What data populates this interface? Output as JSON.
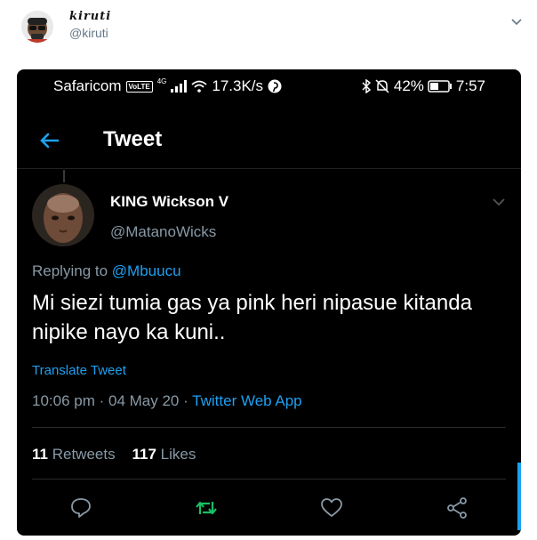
{
  "outer": {
    "name": "kiruti",
    "handle": "@kiruti",
    "chevron_icon": "chevron-down-icon"
  },
  "statusbar": {
    "carrier": "Safaricom",
    "volte": "VoLTE",
    "network": "4G",
    "speed": "17.3K/s",
    "battery": "42%",
    "time": "7:57"
  },
  "header": {
    "title": "Tweet",
    "back_icon": "arrow-left-icon"
  },
  "tweet": {
    "author_name": "KING Wickson V",
    "author_handle": "@MatanoWicks",
    "replying_prefix": "Replying to ",
    "replying_to": "@Mbuucu",
    "text": "Mi siezi tumia gas ya pink heri nipasue kitanda nipike nayo ka kuni..",
    "translate": "Translate Tweet",
    "timestamp": "10:06 pm · 04 May 20 · ",
    "source": "Twitter Web App",
    "retweets_count": "11",
    "retweets_label": " Retweets",
    "likes_count": "117",
    "likes_label": " Likes"
  },
  "actions": [
    "reply-icon",
    "retweet-icon",
    "like-icon",
    "share-icon"
  ],
  "colors": {
    "accent": "#1da1f2",
    "retweet": "#17bf63",
    "muted": "#8899a6",
    "background": "#000000"
  }
}
